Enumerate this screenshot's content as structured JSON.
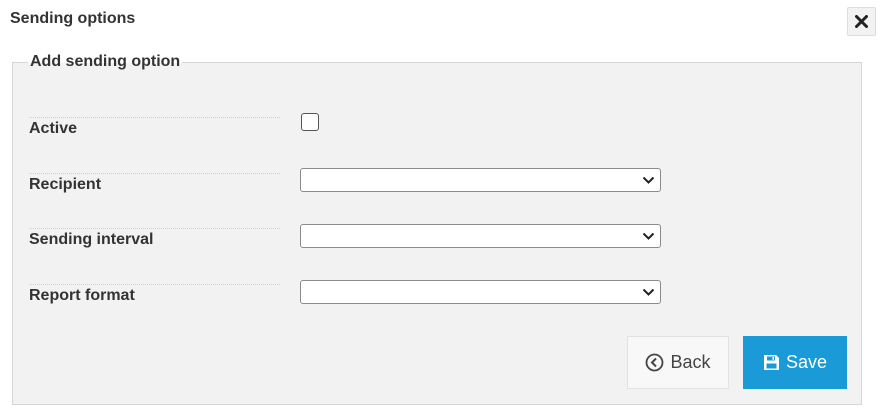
{
  "dialog": {
    "title": "Sending options",
    "close_icon": "close-x-icon"
  },
  "form": {
    "legend": "Add sending option",
    "fields": [
      {
        "label": "Active",
        "type": "checkbox",
        "checked": false
      },
      {
        "label": "Recipient",
        "type": "select",
        "value": ""
      },
      {
        "label": "Sending interval",
        "type": "select",
        "value": ""
      },
      {
        "label": "Report format",
        "type": "select",
        "value": ""
      }
    ]
  },
  "buttons": {
    "back_label": "Back",
    "back_icon": "chevron-left-circle-icon",
    "save_label": "Save",
    "save_icon": "floppy-disk-icon"
  },
  "colors": {
    "primary": "#1a9ad6",
    "panel_bg": "#f2f2f2"
  }
}
